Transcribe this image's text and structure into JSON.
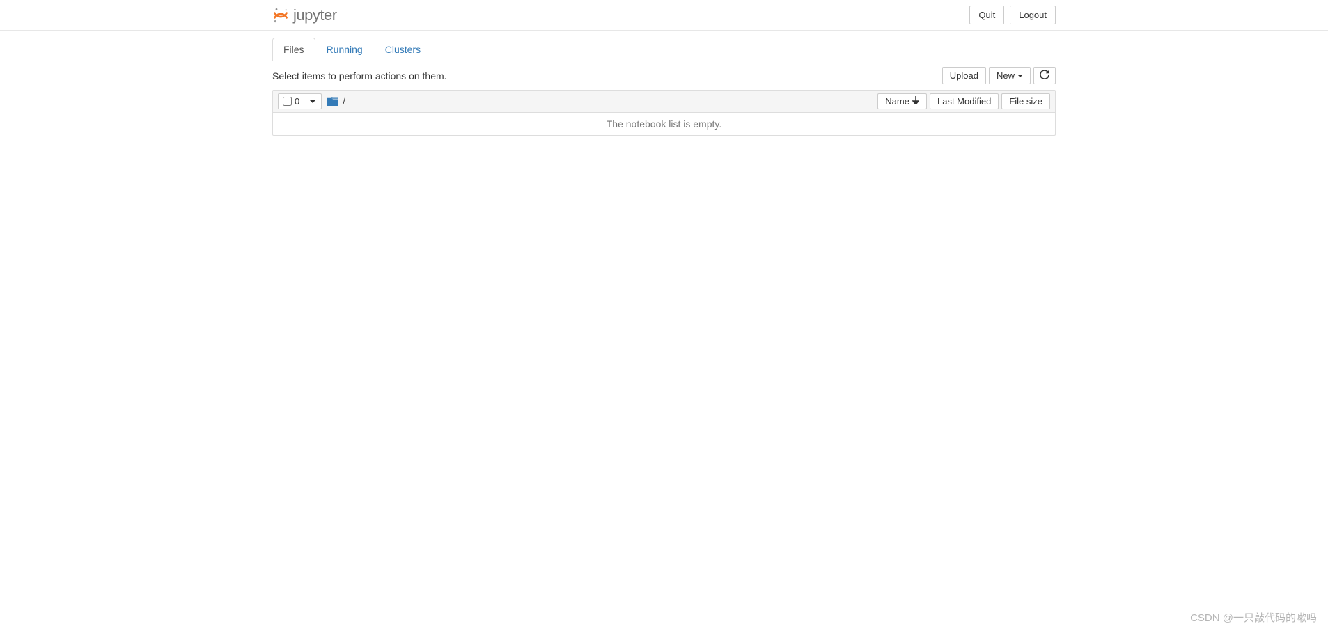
{
  "header": {
    "logo_text": "jupyter",
    "quit_label": "Quit",
    "logout_label": "Logout"
  },
  "tabs": {
    "files": "Files",
    "running": "Running",
    "clusters": "Clusters"
  },
  "toolbar": {
    "prompt": "Select items to perform actions on them.",
    "upload_label": "Upload",
    "new_label": "New"
  },
  "list_header": {
    "select_count": "0",
    "breadcrumb_sep": "/",
    "sort_name": "Name",
    "sort_last_modified": "Last Modified",
    "sort_file_size": "File size"
  },
  "list": {
    "empty_message": "The notebook list is empty."
  },
  "watermark": "CSDN @一只敲代码的嗽吗"
}
